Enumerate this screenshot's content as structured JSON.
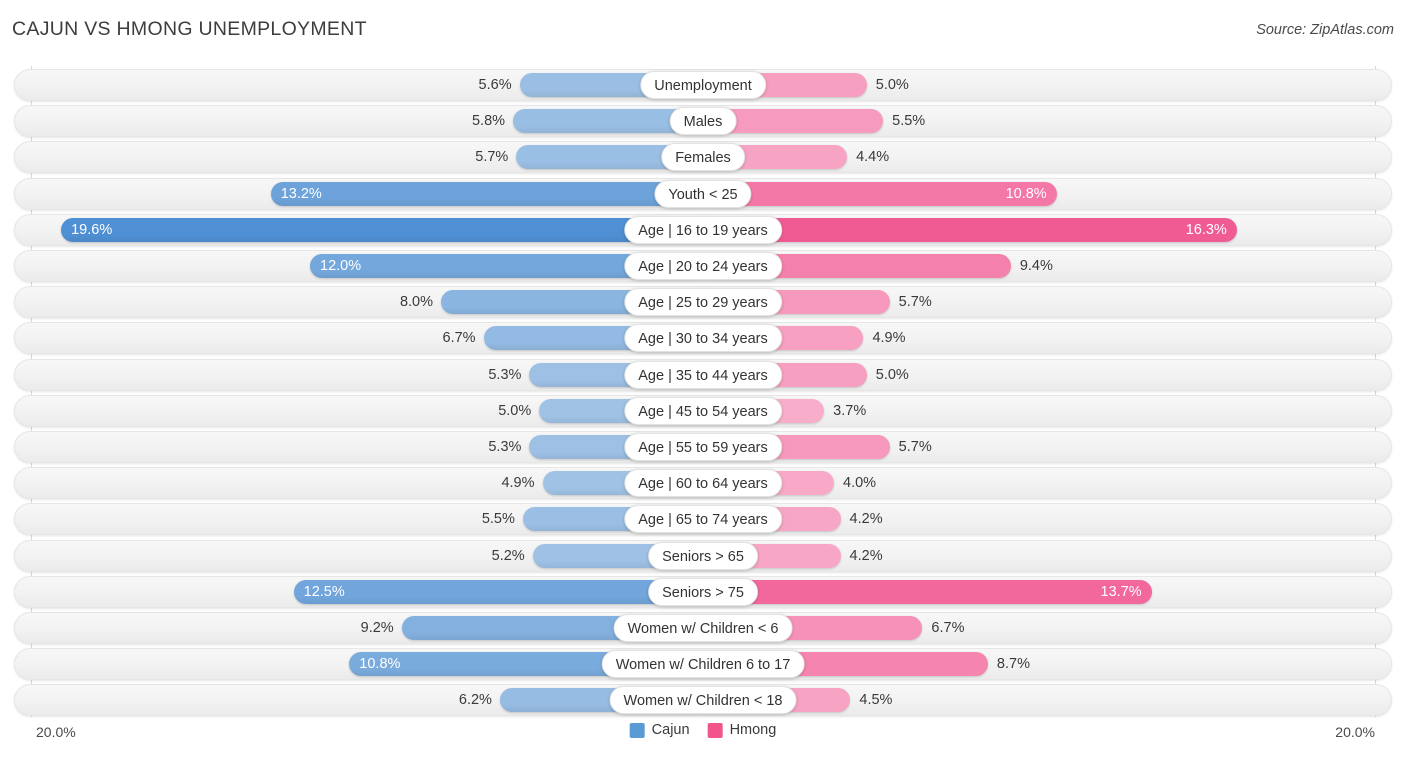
{
  "header": {
    "title": "CAJUN VS HMONG UNEMPLOYMENT",
    "source": "Source: ZipAtlas.com"
  },
  "footer": {
    "left_axis_label": "20.0%",
    "right_axis_label": "20.0%"
  },
  "legend": {
    "items": [
      {
        "label": "Cajun",
        "color": "#5B9BD5"
      },
      {
        "label": "Hmong",
        "color": "#F2558C"
      }
    ]
  },
  "colors": {
    "cajun_min": "#AECBE8",
    "cajun_max": "#4F90D4",
    "hmong_min": "#F8AECA",
    "hmong_max": "#F04B8A",
    "track": "#f2f2f2",
    "axis": "#d8d8d8"
  },
  "chart_data": {
    "type": "bar",
    "subtype": "diverging-horizontal-bar",
    "title": "CAJUN VS HMONG UNEMPLOYMENT",
    "xlabel": "",
    "ylabel": "",
    "xlim": [
      0,
      20
    ],
    "axis_max_percent": 20.0,
    "grid": false,
    "legend_position": "bottom-center",
    "units": "%",
    "categories": [
      "Unemployment",
      "Males",
      "Females",
      "Youth < 25",
      "Age | 16 to 19 years",
      "Age | 20 to 24 years",
      "Age | 25 to 29 years",
      "Age | 30 to 34 years",
      "Age | 35 to 44 years",
      "Age | 45 to 54 years",
      "Age | 55 to 59 years",
      "Age | 60 to 64 years",
      "Age | 65 to 74 years",
      "Seniors > 65",
      "Seniors > 75",
      "Women w/ Children < 6",
      "Women w/ Children 6 to 17",
      "Women w/ Children < 18"
    ],
    "series": [
      {
        "name": "Cajun",
        "side": "left",
        "color": "#5B9BD5",
        "values": [
          5.6,
          5.8,
          5.7,
          13.2,
          19.6,
          12.0,
          8.0,
          6.7,
          5.3,
          5.0,
          5.3,
          4.9,
          5.5,
          5.2,
          12.5,
          9.2,
          10.8,
          6.2
        ],
        "labels": [
          "5.6%",
          "5.8%",
          "5.7%",
          "13.2%",
          "19.6%",
          "12.0%",
          "8.0%",
          "6.7%",
          "5.3%",
          "5.0%",
          "5.3%",
          "4.9%",
          "5.5%",
          "5.2%",
          "12.5%",
          "9.2%",
          "10.8%",
          "6.2%"
        ]
      },
      {
        "name": "Hmong",
        "side": "right",
        "color": "#F2558C",
        "values": [
          5.0,
          5.5,
          4.4,
          10.8,
          16.3,
          9.4,
          5.7,
          4.9,
          5.0,
          3.7,
          5.7,
          4.0,
          4.2,
          4.2,
          13.7,
          6.7,
          8.7,
          4.5
        ],
        "labels": [
          "5.0%",
          "5.5%",
          "4.4%",
          "10.8%",
          "16.3%",
          "9.4%",
          "5.7%",
          "4.9%",
          "5.0%",
          "3.7%",
          "5.7%",
          "4.0%",
          "4.2%",
          "4.2%",
          "13.7%",
          "6.7%",
          "8.7%",
          "4.5%"
        ]
      }
    ]
  }
}
